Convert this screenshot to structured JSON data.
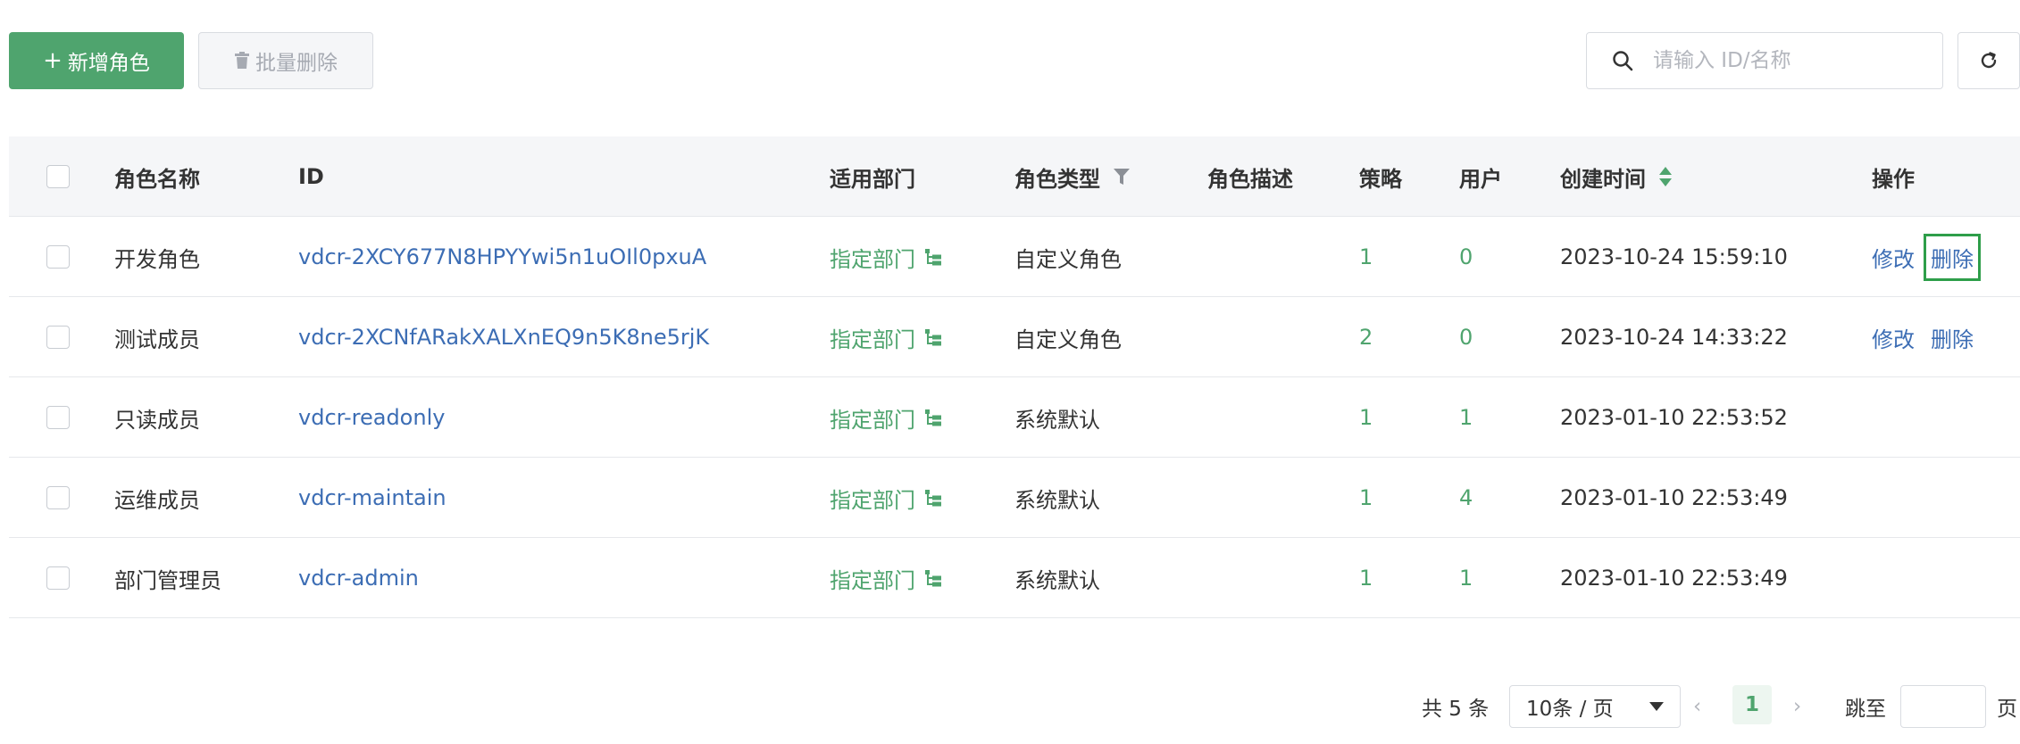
{
  "toolbar": {
    "add_label": "新增角色",
    "add_plus": "+",
    "batch_delete_label": "批量删除",
    "search_placeholder": "请输入 ID/名称"
  },
  "table": {
    "columns": {
      "name": "角色名称",
      "id": "ID",
      "dept": "适用部门",
      "type": "角色类型",
      "desc": "角色描述",
      "policy": "策略",
      "user": "用户",
      "time": "创建时间",
      "op": "操作"
    },
    "rows": [
      {
        "name": "开发角色",
        "id": "vdcr-2XCY677N8HPYYwi5n1uOIl0pxuA",
        "dept": "指定部门",
        "type": "自定义角色",
        "policy": "1",
        "user": "0",
        "time": "2023-10-24 15:59:10",
        "edit": "修改",
        "delete": "删除"
      },
      {
        "name": "测试成员",
        "id": "vdcr-2XCNfARakXALXnEQ9n5K8ne5rjK",
        "dept": "指定部门",
        "type": "自定义角色",
        "policy": "2",
        "user": "0",
        "time": "2023-10-24 14:33:22",
        "edit": "修改",
        "delete": "删除"
      },
      {
        "name": "只读成员",
        "id": "vdcr-readonly",
        "dept": "指定部门",
        "type": "系统默认",
        "policy": "1",
        "user": "1",
        "time": "2023-01-10 22:53:52"
      },
      {
        "name": "运维成员",
        "id": "vdcr-maintain",
        "dept": "指定部门",
        "type": "系统默认",
        "policy": "1",
        "user": "4",
        "time": "2023-01-10 22:53:49"
      },
      {
        "name": "部门管理员",
        "id": "vdcr-admin",
        "dept": "指定部门",
        "type": "系统默认",
        "policy": "1",
        "user": "1",
        "time": "2023-01-10 22:53:49"
      }
    ]
  },
  "pagination": {
    "total": "共 5 条",
    "page_size": "10条 / 页",
    "current_page": "1",
    "prev": "‹",
    "next": "›",
    "jump_label": "跳至",
    "jump_unit": "页"
  },
  "colors": {
    "primary": "#4fa46e",
    "link": "#3c6db4",
    "focus_outline": "#2e9e4a"
  },
  "icons": {
    "search": "search-icon",
    "refresh": "refresh-icon",
    "trash": "trash-icon",
    "filter": "filter-icon",
    "sort": "sort-icon",
    "dept_tree": "tree-icon"
  }
}
